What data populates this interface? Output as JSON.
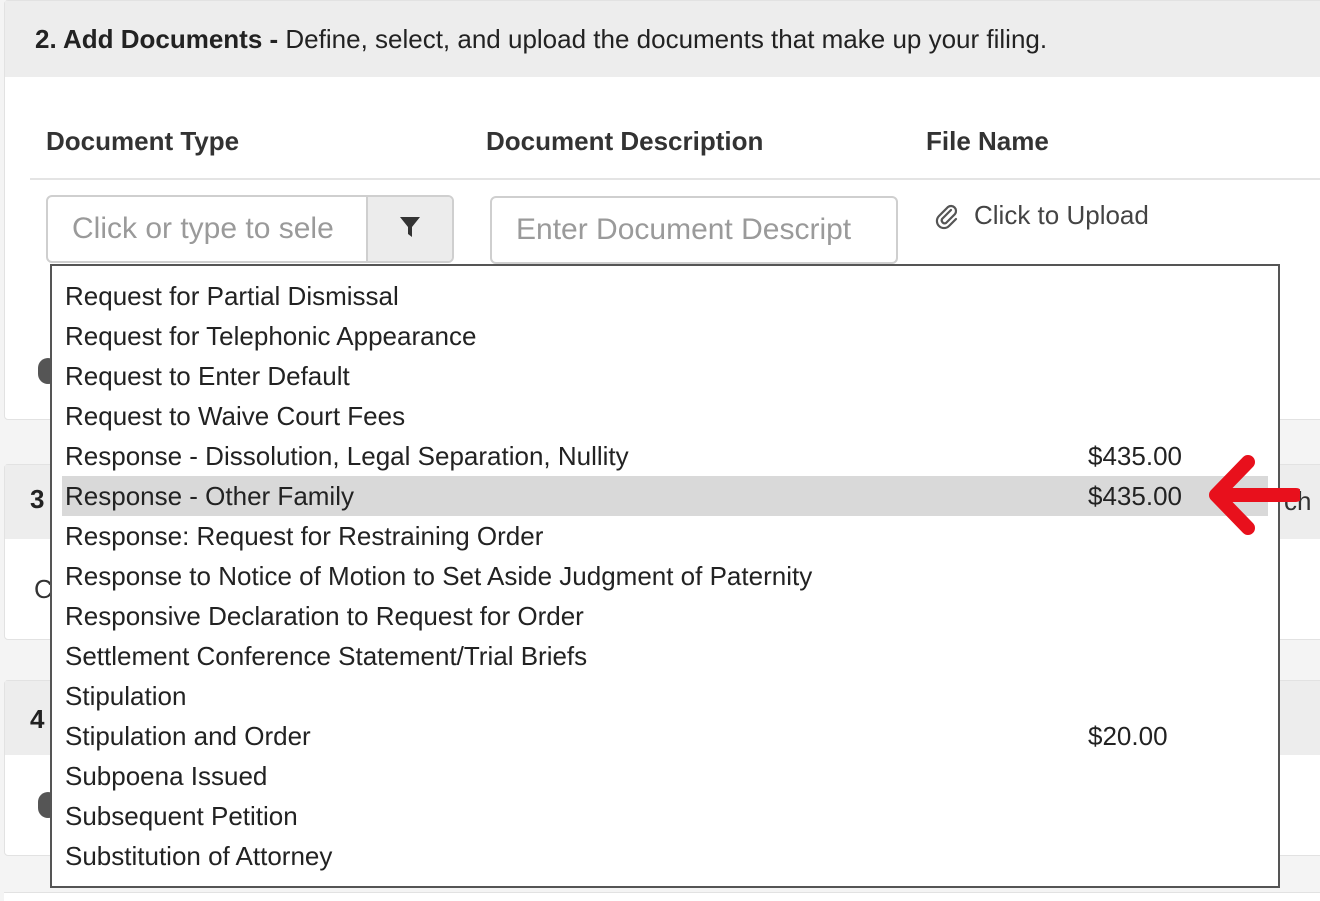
{
  "section2": {
    "number": "2. Add Documents -",
    "description": "Define, select, and upload the documents that make up your filing."
  },
  "columns": {
    "document_type": "Document Type",
    "document_description": "Document Description",
    "file_name": "File Name"
  },
  "doc_type_input": {
    "placeholder": "Click or type to sele",
    "filter_icon": "filter-icon"
  },
  "doc_desc_input": {
    "placeholder": "Enter Document Descript"
  },
  "upload": {
    "label": "Click to Upload",
    "icon": "paperclip-icon"
  },
  "section3": {
    "number": "3",
    "peek_right": "ch",
    "peek_left": "C"
  },
  "section4": {
    "number": "4"
  },
  "dropdown": {
    "items": [
      {
        "label": "Request for Partial Dismissal",
        "price": ""
      },
      {
        "label": "Request for Telephonic Appearance",
        "price": ""
      },
      {
        "label": "Request to Enter Default",
        "price": ""
      },
      {
        "label": "Request to Waive Court Fees",
        "price": ""
      },
      {
        "label": "Response - Dissolution, Legal Separation, Nullity",
        "price": "$435.00"
      },
      {
        "label": "Response - Other Family",
        "price": "$435.00",
        "selected": true
      },
      {
        "label": "Response: Request for Restraining Order",
        "price": ""
      },
      {
        "label": "Response to Notice of Motion to Set Aside Judgment of Paternity",
        "price": ""
      },
      {
        "label": "Responsive Declaration to Request for Order",
        "price": ""
      },
      {
        "label": "Settlement Conference Statement/Trial Briefs",
        "price": ""
      },
      {
        "label": "Stipulation",
        "price": ""
      },
      {
        "label": "Stipulation and Order",
        "price": "$20.00"
      },
      {
        "label": "Subpoena Issued",
        "price": ""
      },
      {
        "label": "Subsequent Petition",
        "price": ""
      },
      {
        "label": "Substitution of Attorney",
        "price": ""
      }
    ]
  },
  "annotation": {
    "icon": "red-arrow-left-icon",
    "color": "#e8101c"
  },
  "colors": {
    "header_bg": "#ededed",
    "selected_bg": "#d9d9d9"
  }
}
